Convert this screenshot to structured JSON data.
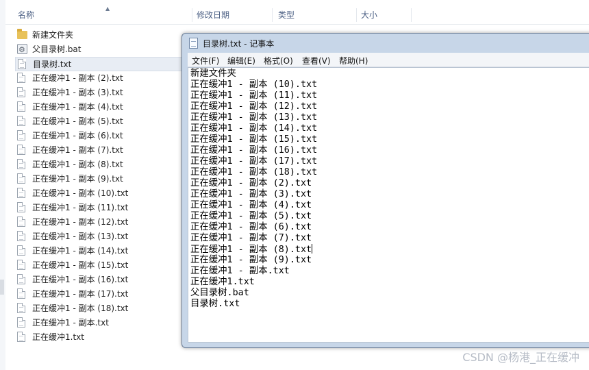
{
  "explorer": {
    "columns": {
      "name": "名称",
      "modified": "修改日期",
      "type": "类型",
      "size": "大小"
    },
    "files": [
      {
        "name": "新建文件夹",
        "icon": "folder-icon"
      },
      {
        "name": "父目录树.bat",
        "icon": "bat-file-icon"
      },
      {
        "name": "目录树.txt",
        "icon": "txt-file-icon",
        "selected": true
      },
      {
        "name": "正在缓冲1 - 副本 (2).txt",
        "icon": "txt-file-icon"
      },
      {
        "name": "正在缓冲1 - 副本 (3).txt",
        "icon": "txt-file-icon"
      },
      {
        "name": "正在缓冲1 - 副本 (4).txt",
        "icon": "txt-file-icon"
      },
      {
        "name": "正在缓冲1 - 副本 (5).txt",
        "icon": "txt-file-icon"
      },
      {
        "name": "正在缓冲1 - 副本 (6).txt",
        "icon": "txt-file-icon"
      },
      {
        "name": "正在缓冲1 - 副本 (7).txt",
        "icon": "txt-file-icon"
      },
      {
        "name": "正在缓冲1 - 副本 (8).txt",
        "icon": "txt-file-icon"
      },
      {
        "name": "正在缓冲1 - 副本 (9).txt",
        "icon": "txt-file-icon"
      },
      {
        "name": "正在缓冲1 - 副本 (10).txt",
        "icon": "txt-file-icon"
      },
      {
        "name": "正在缓冲1 - 副本 (11).txt",
        "icon": "txt-file-icon"
      },
      {
        "name": "正在缓冲1 - 副本 (12).txt",
        "icon": "txt-file-icon"
      },
      {
        "name": "正在缓冲1 - 副本 (13).txt",
        "icon": "txt-file-icon"
      },
      {
        "name": "正在缓冲1 - 副本 (14).txt",
        "icon": "txt-file-icon"
      },
      {
        "name": "正在缓冲1 - 副本 (15).txt",
        "icon": "txt-file-icon"
      },
      {
        "name": "正在缓冲1 - 副本 (16).txt",
        "icon": "txt-file-icon"
      },
      {
        "name": "正在缓冲1 - 副本 (17).txt",
        "icon": "txt-file-icon"
      },
      {
        "name": "正在缓冲1 - 副本 (18).txt",
        "icon": "txt-file-icon"
      },
      {
        "name": "正在缓冲1 - 副本.txt",
        "icon": "txt-file-icon"
      },
      {
        "name": "正在缓冲1.txt",
        "icon": "txt-file-icon"
      }
    ]
  },
  "notepad": {
    "title": "目录树.txt - 记事本",
    "menu": [
      "文件(F)",
      "编辑(E)",
      "格式(O)",
      "查看(V)",
      "帮助(H)"
    ],
    "lines": [
      "新建文件夹",
      "正在缓冲1 - 副本 (10).txt",
      "正在缓冲1 - 副本 (11).txt",
      "正在缓冲1 - 副本 (12).txt",
      "正在缓冲1 - 副本 (13).txt",
      "正在缓冲1 - 副本 (14).txt",
      "正在缓冲1 - 副本 (15).txt",
      "正在缓冲1 - 副本 (16).txt",
      "正在缓冲1 - 副本 (17).txt",
      "正在缓冲1 - 副本 (18).txt",
      "正在缓冲1 - 副本 (2).txt",
      "正在缓冲1 - 副本 (3).txt",
      "正在缓冲1 - 副本 (4).txt",
      "正在缓冲1 - 副本 (5).txt",
      "正在缓冲1 - 副本 (6).txt",
      "正在缓冲1 - 副本 (7).txt",
      "正在缓冲1 - 副本 (8).txt",
      "正在缓冲1 - 副本 (9).txt",
      "正在缓冲1 - 副本.txt",
      "正在缓冲1.txt",
      "父目录树.bat",
      "目录树.txt"
    ]
  },
  "watermark": "CSDN @杨港_正在缓冲"
}
